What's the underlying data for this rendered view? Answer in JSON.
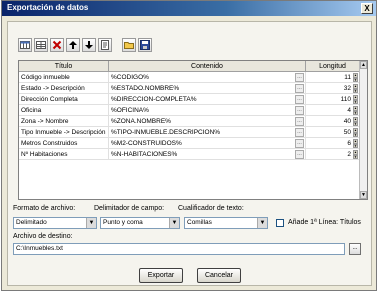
{
  "window": {
    "title": "Exportación de datos",
    "close_label": "X"
  },
  "toolbar": {
    "buttons": [
      {
        "name": "columns-a-icon"
      },
      {
        "name": "columns-b-icon"
      },
      {
        "name": "delete-icon"
      },
      {
        "name": "arrow-up-icon"
      },
      {
        "name": "arrow-down-icon"
      },
      {
        "name": "properties-icon"
      },
      {
        "name": "open-folder-icon"
      },
      {
        "name": "save-icon"
      }
    ]
  },
  "grid": {
    "headers": {
      "titulo": "Título",
      "contenido": "Contenido",
      "longitud": "Longitud"
    },
    "rows": [
      {
        "titulo": "Código inmueble",
        "contenido": "%CODIGO%",
        "longitud": "11"
      },
      {
        "titulo": "Estado -> Descripción",
        "contenido": "%ESTADO.NOMBRE%",
        "longitud": "32"
      },
      {
        "titulo": "Dirección Completa",
        "contenido": "%DIRECCION-COMPLETA%",
        "longitud": "110"
      },
      {
        "titulo": "Oficina",
        "contenido": "%OFICINA%",
        "longitud": "4"
      },
      {
        "titulo": "Zona -> Nombre",
        "contenido": "%ZONA.NOMBRE%",
        "longitud": "40"
      },
      {
        "titulo": "Tipo Inmueble -> Descripción",
        "contenido": "%TIPO-INMUEBLE.DESCRIPCION%",
        "longitud": "50"
      },
      {
        "titulo": "Metros Construidos",
        "contenido": "%M2-CONSTRUIDOS%",
        "longitud": "6"
      },
      {
        "titulo": "Nº Habitaciones",
        "contenido": "%N-HABITACIONES%",
        "longitud": "2"
      }
    ]
  },
  "format": {
    "archivo_label": "Formato de archivo:",
    "archivo_value": "Delimitado",
    "delimitador_label": "Delimitador de campo:",
    "delimitador_value": "Punto y coma",
    "cualificador_label": "Cualificador de texto:",
    "cualificador_value": "Comillas",
    "titles_checkbox_label": "Añade 1ª Línea: Títulos"
  },
  "destino": {
    "label": "Archivo de destino:",
    "value": "C:\\Inmuebles.txt",
    "browse_label": "..."
  },
  "actions": {
    "exportar": "Exportar",
    "cancelar": "Cancelar"
  }
}
